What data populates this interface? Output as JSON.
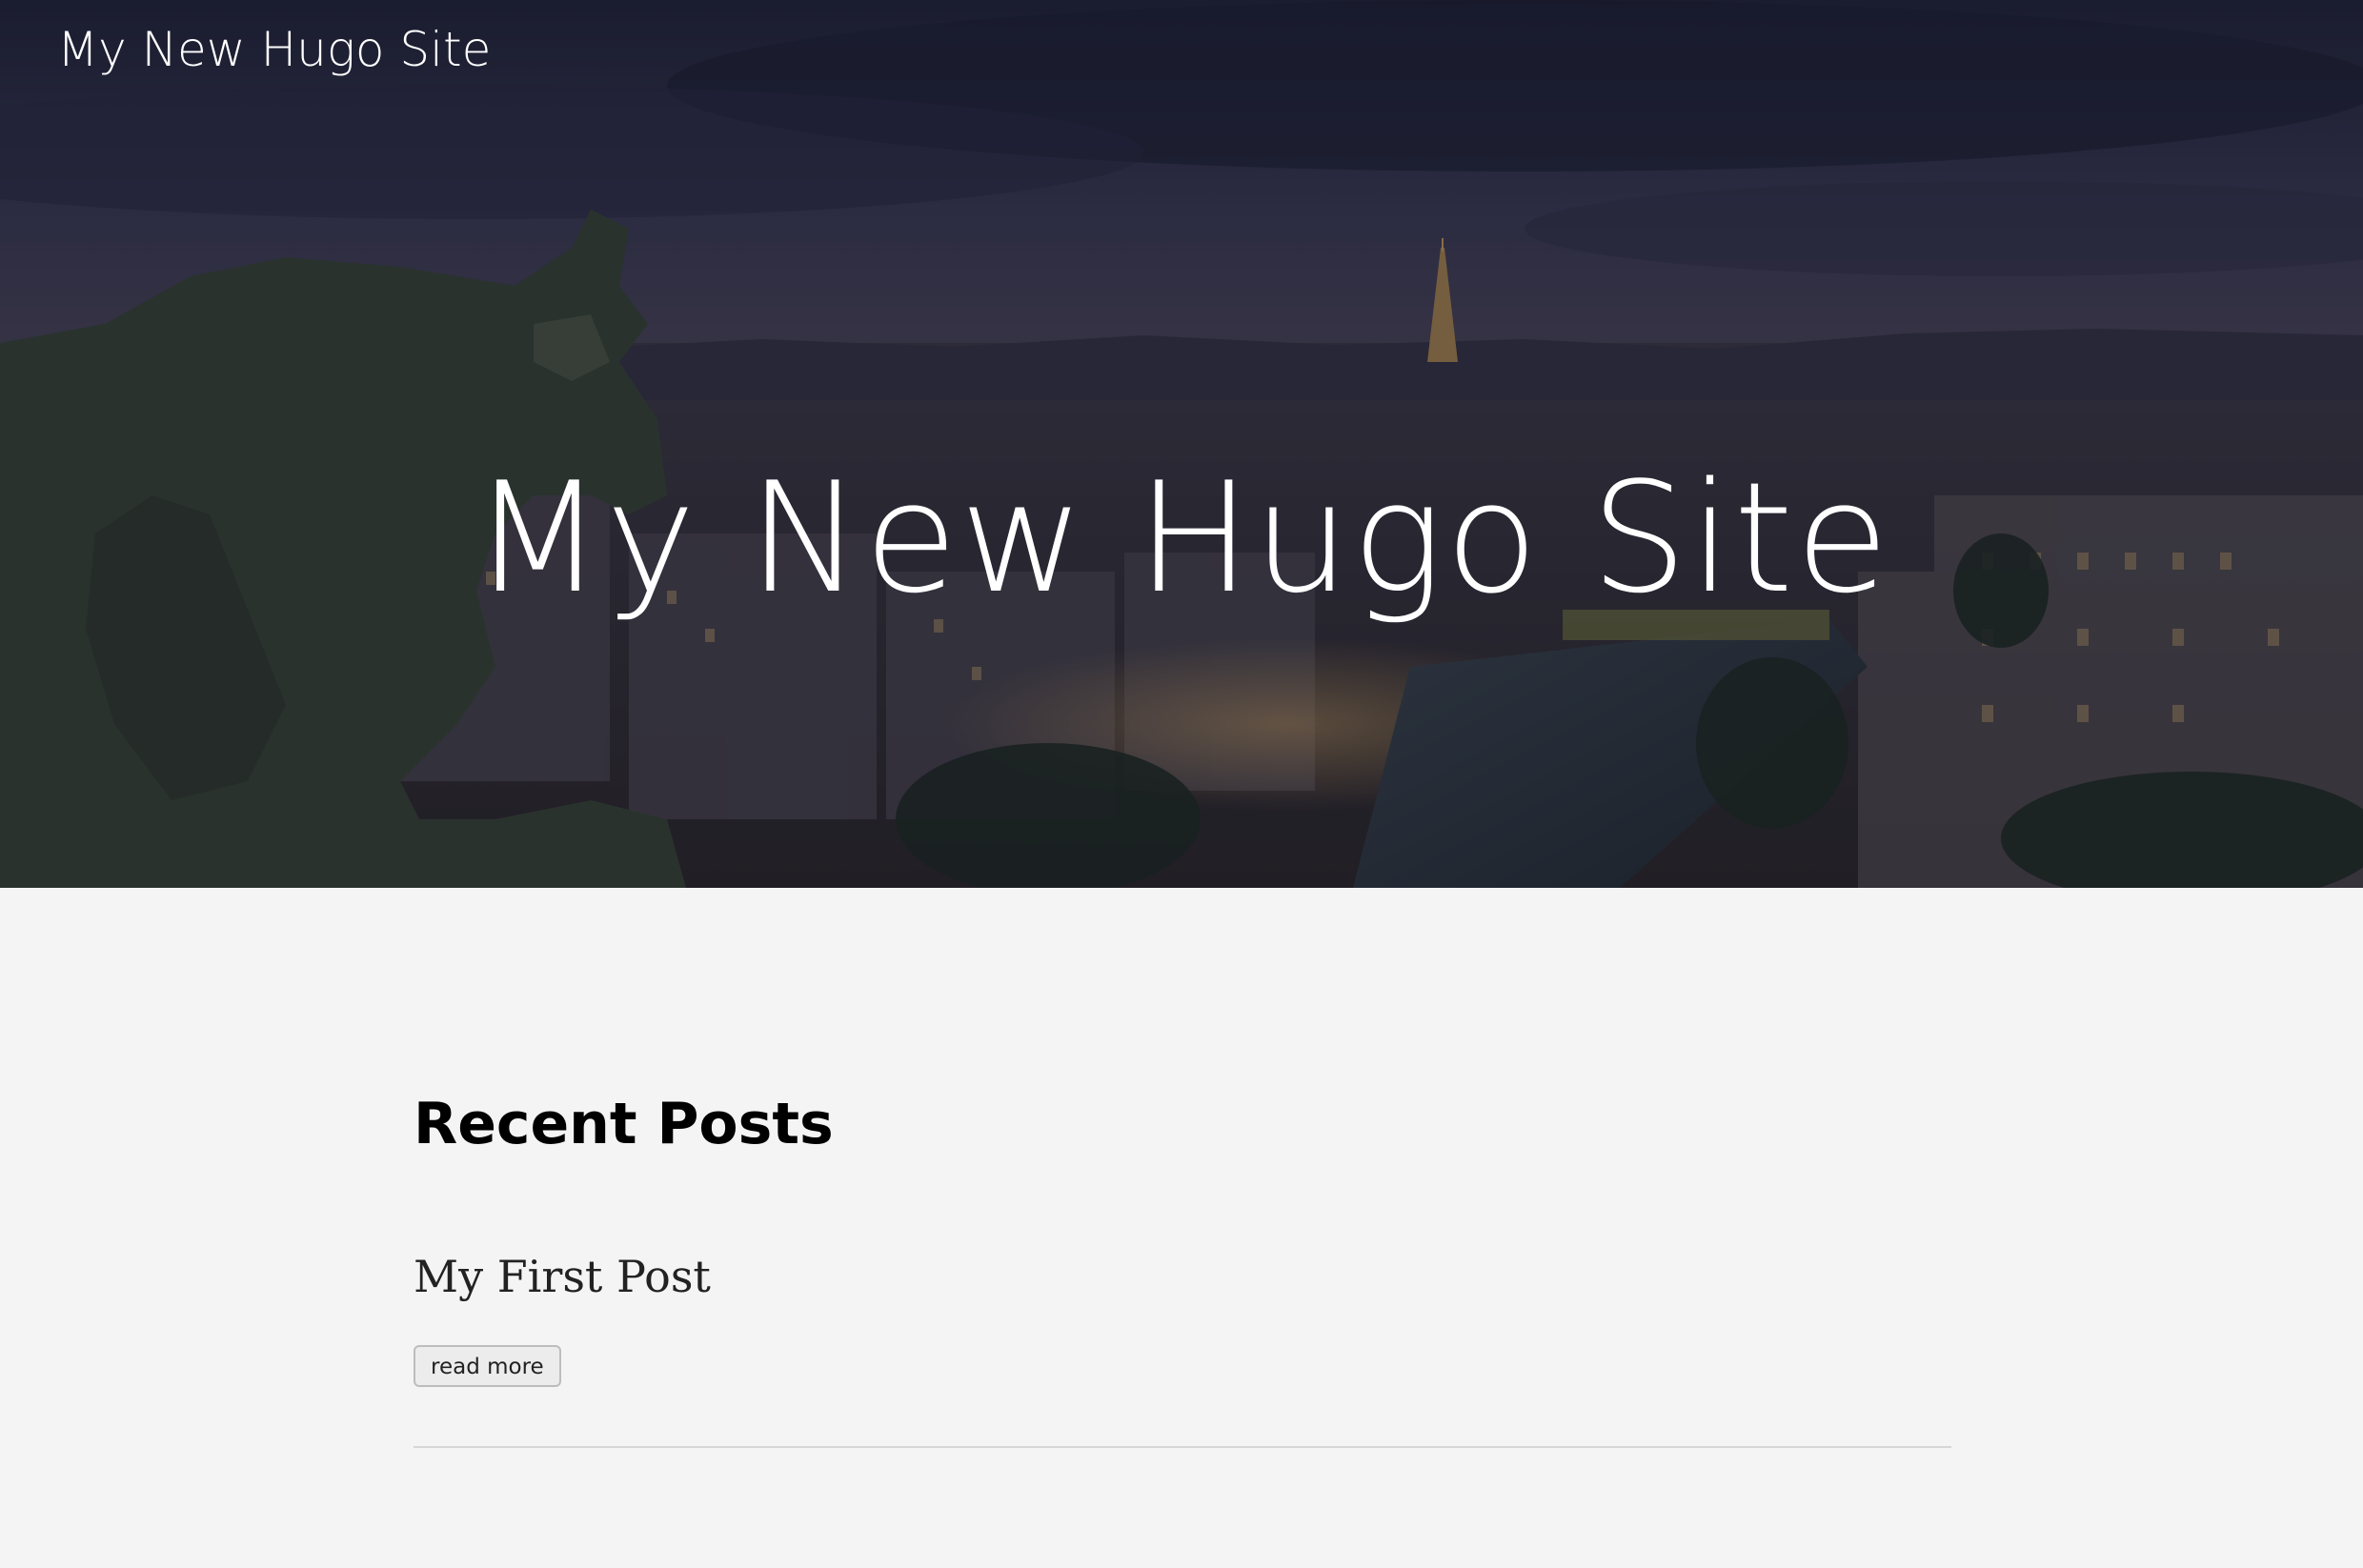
{
  "header": {
    "site_name": "My New Hugo Site"
  },
  "hero": {
    "title": "My New Hugo Site",
    "image_description_icon": "paris-skyline-hero-image"
  },
  "main": {
    "section_title": "Recent Posts",
    "posts": [
      {
        "title": "My First Post",
        "read_more_label": "read more"
      }
    ]
  },
  "colors": {
    "page_background": "#f4f4f4",
    "hero_text": "#ffffff",
    "heading_text": "#000000",
    "post_title_text": "#222222",
    "button_border": "#bdbdbd",
    "divider": "#d6d6d6"
  }
}
